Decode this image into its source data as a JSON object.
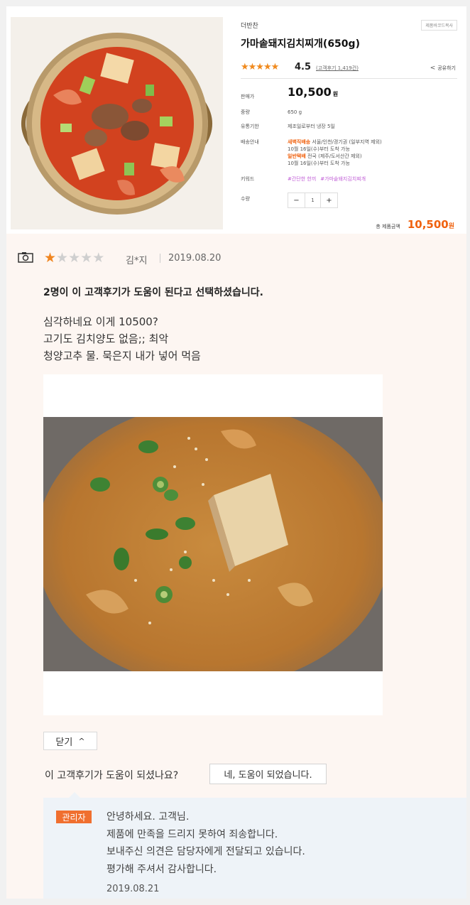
{
  "product": {
    "brand": "더반찬",
    "barcode_button": "제품바코드복사",
    "title": "가마솥돼지김치찌개(650g)",
    "rating_stars": "★★★★★",
    "rating_score": "4.5",
    "review_count": "(고객후기 1,419건)",
    "share_label": "공유하기",
    "price_label": "판매가",
    "price": "10,500",
    "price_unit": "원",
    "weight_label": "중량",
    "weight": "650 g",
    "expiry_label": "유통기한",
    "expiry": "제조일로부터 냉장 5일",
    "delivery_label": "배송안내",
    "delivery_dawn_tag": "새벽직배송",
    "delivery_dawn_text": " 서울/인천/경기권 (일부지역 제외)",
    "delivery_dawn_date": "10월 16일(수)부터 도착 가능",
    "delivery_normal_tag": "일반택배",
    "delivery_normal_text": " 전국 (제주/도서산간 제외)",
    "delivery_normal_date": "10월 16일(수)부터 도착 가능",
    "keyword_label": "키워드",
    "keywords": [
      "#간단한 한끼",
      "#가마솥돼지김치찌개"
    ],
    "qty_label": "수량",
    "qty_minus": "−",
    "qty_value": "1",
    "qty_plus": "+",
    "total_label": "총 제품금액",
    "total_value": "10,500",
    "total_unit": "원"
  },
  "review": {
    "rating": 1,
    "rating_max": 5,
    "reviewer": "김*지",
    "date": "2019.08.20",
    "helpful_count_text": "2명이 이 고객후기가 도움이 된다고 선택하셨습니다.",
    "body_lines": [
      "심각하네요 이게 10500?",
      "고기도 김치양도 없음;; 최악",
      "청양고추 물. 묵은지 내가 넣어 먹음"
    ],
    "close_label": "닫기",
    "helpful_question": "이 고객후기가 도움이 되셨나요?",
    "helpful_button": "네, 도움이 되었습니다."
  },
  "reply": {
    "badge": "관리자",
    "lines": [
      "안녕하세요. 고객님.",
      "제품에 만족을 드리지 못하여 죄송합니다.",
      "보내주신 의견은 담당자에게 전달되고 있습니다.",
      "평가해 주셔서 감사합니다."
    ],
    "date": "2019.08.21"
  },
  "colors": {
    "accent_orange": "#f0620f",
    "star": "#f0851f",
    "review_bg": "#fdf6f2",
    "reply_bg": "#eef3f8"
  }
}
